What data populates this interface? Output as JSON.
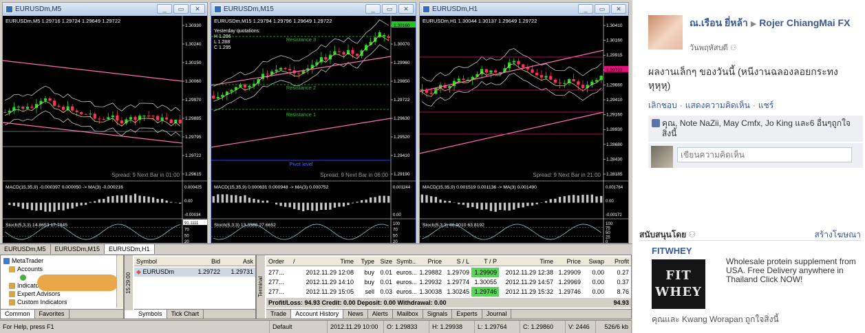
{
  "charts": [
    {
      "window_title": "EURUSDm,M5",
      "header": "EURUSDm,M5  1.29716 1.29724 1.29649 1.29722",
      "overlay_lines": [],
      "price_labels": [
        "1.30330",
        "1.30240",
        "1.30150",
        "1.30060",
        "1.29970",
        "1.29885",
        "1.29795",
        "1.29722",
        "1.29615"
      ],
      "highlight_price": "",
      "spread_text": "Spread: 9   Next Bar in 01:00",
      "macd_header": "MACD(15,35,9) -0.000397 0.000050 -> MA(3) -0.000216",
      "macd_labels": [
        "0.000425",
        "0.00",
        "-0.00034"
      ],
      "stoch_header": "Stoch(5,3,3) 14.8653 17.7845",
      "stoch_labels": [
        "100",
        "70",
        "50",
        "20"
      ],
      "scale_extra": "91.1111"
    },
    {
      "window_title": "EURUSDm,M15",
      "header": "EURUSDm,M15  1.29794 1.29796 1.29649 1.29722",
      "overlay_lines": [
        "Yesterday quotations:",
        "H 1.296",
        "L 1.288",
        "C 1.295"
      ],
      "resistance_label": "Resistance 3",
      "resistance2_label": "Resistance 2",
      "resistance1_label": "Resistance 1",
      "pivot_label": "Pivot level",
      "price_labels": [
        "1.30160",
        "1.30070",
        "1.29960",
        "1.29850",
        "1.29722",
        "1.29630",
        "1.29520",
        "1.29410",
        "1.29190"
      ],
      "highlight_price": "1.30160",
      "spread_text": "Spread: 9   Next Bar in 06:00",
      "macd_header": "MACD(15,35,9) 0.000631 0.000948 -> MA(3) 0.000752",
      "macd_labels": [
        "0.001244",
        "0.00"
      ],
      "stoch_header": "Stoch(5,3,3) 13.3388 27.6652",
      "stoch_labels": [
        "100",
        "70",
        "50",
        "20"
      ],
      "scale_extra": ""
    },
    {
      "window_title": "EURUSDm,H1",
      "header": "EURUSDm,H1  1.30044 1.30137 1.29649 1.29722",
      "overlay_lines": [],
      "price_labels": [
        "1.30410",
        "1.30160",
        "1.29915",
        "1.29722",
        "1.29660",
        "1.29410",
        "1.29160",
        "1.28930",
        "1.28680",
        "1.28430",
        "1.28185"
      ],
      "highlight_price": "1.29722",
      "spread_text": "Spread: 9   Next Bar in 21:00",
      "macd_header": "MACD(15,35,9) 0.001519 0.001136 -> MA(3) 0.001490",
      "macd_labels": [
        "0.001764",
        "0.00",
        "-0.00172"
      ],
      "stoch_header": "Stoch(5,3,3) 46.9010 63.8192",
      "stoch_labels": [
        "100",
        "75",
        "50",
        "25",
        "0"
      ],
      "scale_extra": ""
    }
  ],
  "chart_tabs": [
    "EURUSDm,M5",
    "EURUSDm,M15",
    "EURUSDm,H1"
  ],
  "navigator": {
    "items": [
      "MetaTrader",
      "Accounts",
      "",
      "Indicators",
      "Expert Advisors",
      "Custom Indicators"
    ],
    "tabs": [
      "Common",
      "Favorites"
    ]
  },
  "market_watch": {
    "vertical_label": "15:29:00",
    "headers": [
      "Symbol",
      "Bid",
      "Ask"
    ],
    "row": {
      "symbol": "EURUSDm",
      "bid": "1.29722",
      "ask": "1.29731"
    },
    "tabs": [
      "Symbols",
      "Tick Chart"
    ]
  },
  "terminal": {
    "vertical_label": "Terminal",
    "headers": [
      "Order",
      "/",
      "Time",
      "Type",
      "Size",
      "Symb...",
      "Price",
      "S / L",
      "T / P",
      "Time",
      "Price",
      "Swap",
      "Profit"
    ],
    "rows": [
      [
        "277...",
        "2012.11.29 12:08",
        "buy",
        "0.01",
        "euros...",
        "1.29882",
        "1.29709",
        "1.29909",
        "2012.11.29 12:38",
        "1.29909",
        "0.00",
        "0.27"
      ],
      [
        "277...",
        "2012.11.29 14:10",
        "buy",
        "0.01",
        "euros...",
        "1.29932",
        "1.29774",
        "1.30055",
        "2012.11.29 14:57",
        "1.29969",
        "0.00",
        "0.37"
      ],
      [
        "277...",
        "2012.11.29 15:05",
        "sell",
        "0.03",
        "euros...",
        "1.30038",
        "1.30245",
        "1.29746",
        "2012.11.29 15:32",
        "1.29746",
        "0.00",
        "8.76"
      ]
    ],
    "tp_highlight": [
      true,
      false,
      true
    ],
    "summary": "Profit/Loss: 94.93  Credit: 0.00  Deposit: 0.00  Withdrawal: 0.00",
    "summary_total": "94.93",
    "tabs": [
      "Trade",
      "Account History",
      "News",
      "Alerts",
      "Mailbox",
      "Signals",
      "Experts",
      "Journal"
    ]
  },
  "status_bar": [
    "For Help, press F1",
    "Default",
    "2012.11.29 10:00",
    "O: 1.29833",
    "H: 1.29938",
    "L: 1.29764",
    "C: 1.29860",
    "V: 2446",
    "526/6 kb"
  ],
  "facebook": {
    "author": "ณ.เรือน ยี่หล้า",
    "target": "Rojer ChiangMai FX",
    "date": "วันพฤหัสบดี",
    "message": "ผลงานเล็กๆ ของวันนี้ (หนีงานฉลองลอยกระทง หุหุหุ)",
    "actions": [
      "เลิกชอบ",
      "แสดงความคิดเห็น",
      "แชร์"
    ],
    "likes": "คุณ, Note NaZii, May Cmfx, Jo King และ6 อื่นๆถูกใจสิ่งนี้",
    "comment_placeholder": "เขียนความคิดเห็น",
    "sponsored_title": "สนับสนุนโดย",
    "create_ad": "สร้างโฆษณา",
    "ad": {
      "title": "FITWHEY",
      "image_text": "FIT WHEY",
      "text": "Wholesale protein supplement from USA. Free Delivery anywhere in Thailand Click NOW!",
      "likes": "คุณและ Kwang Worapan ถูกใจสิ่งนี้"
    }
  }
}
